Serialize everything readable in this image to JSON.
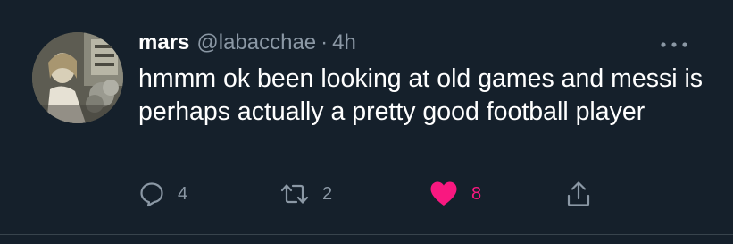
{
  "tweet": {
    "display_name": "mars",
    "handle": "@labacchae",
    "separator": "·",
    "time": "4h",
    "text": "hmmm ok been looking at old games and messi is perhaps actually a pretty good football player",
    "avatar_icon": "profile-photo",
    "more_icon": "more-horizontal-icon"
  },
  "actions": {
    "reply": {
      "icon": "reply-icon",
      "count": "4"
    },
    "retweet": {
      "icon": "retweet-icon",
      "count": "2"
    },
    "like": {
      "icon": "heart-filled-icon",
      "count": "8",
      "liked": true
    },
    "share": {
      "icon": "share-icon"
    }
  },
  "colors": {
    "background": "#15202b",
    "text_primary": "#ffffff",
    "text_secondary": "#8b98a5",
    "like_active": "#f91880"
  }
}
